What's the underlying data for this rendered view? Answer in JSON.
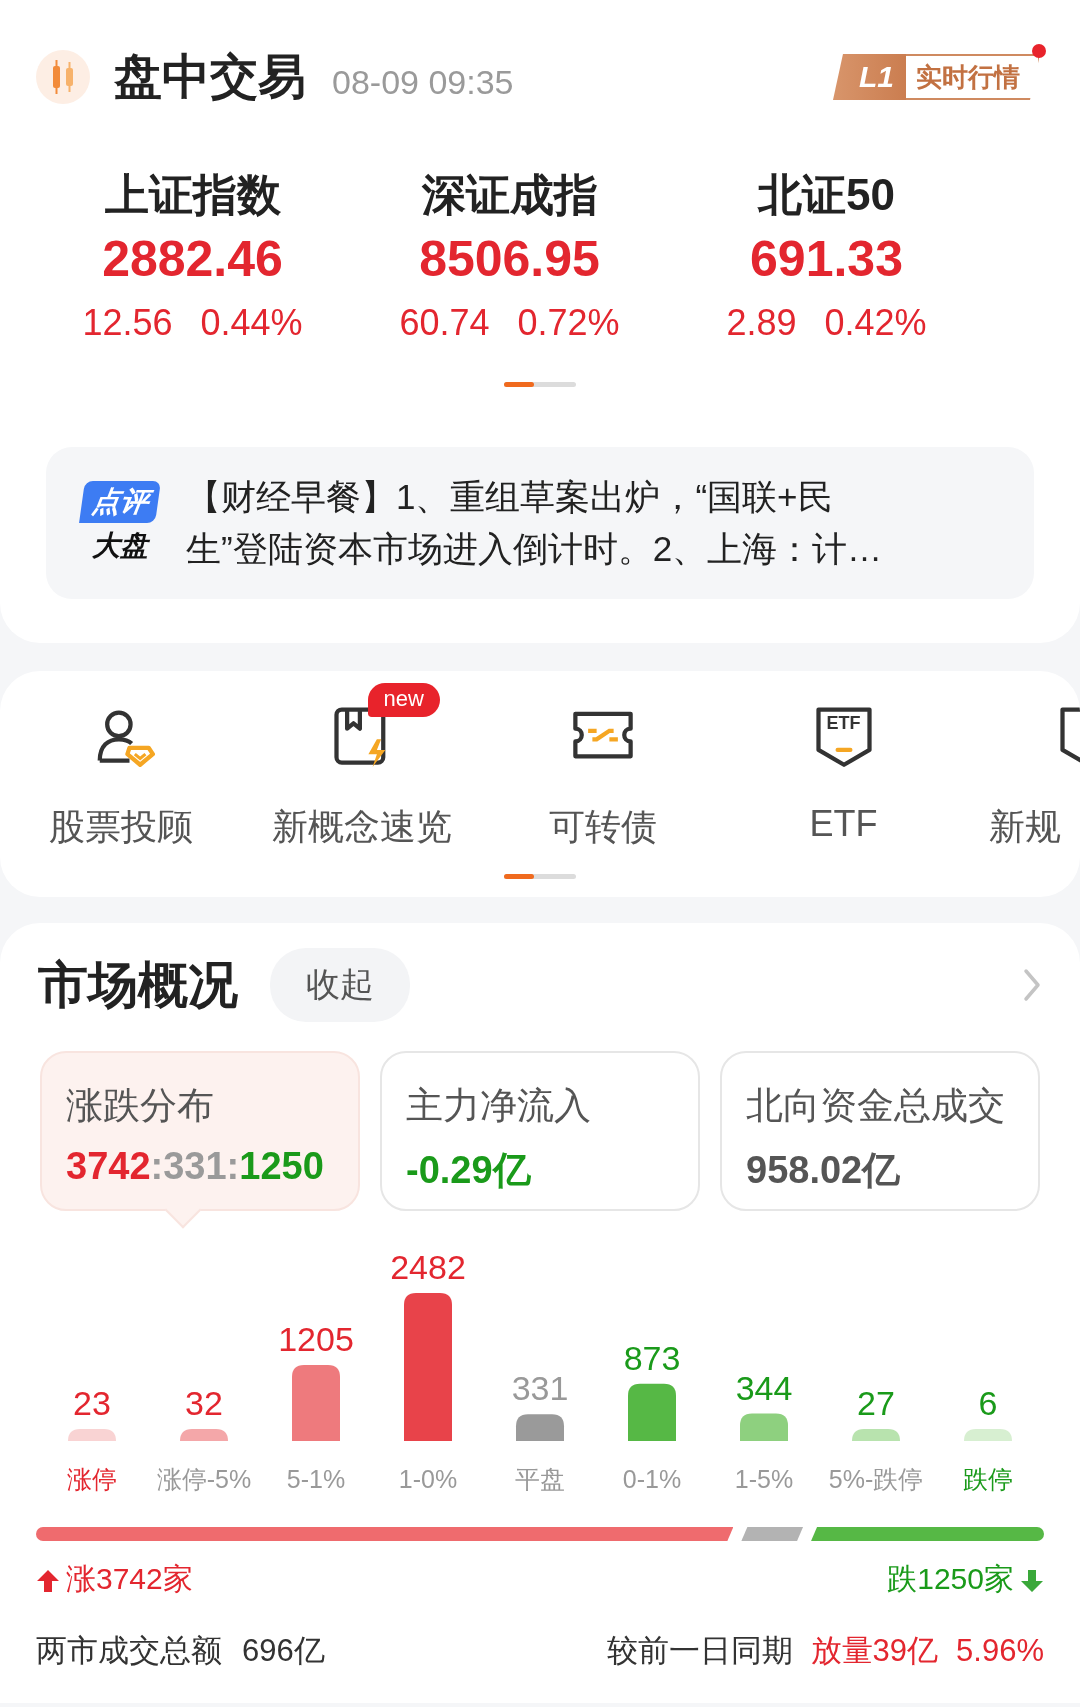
{
  "header": {
    "title": "盘中交易",
    "time": "08-09 09:35",
    "badge": {
      "tag": "L1",
      "label": "实时行情",
      "notification": true
    }
  },
  "indices": [
    {
      "name": "上证指数",
      "value": "2882.46",
      "change": "12.56",
      "percent": "0.44%",
      "kind": "up"
    },
    {
      "name": "深证成指",
      "value": "8506.95",
      "change": "60.74",
      "percent": "0.72%",
      "kind": "up"
    },
    {
      "name": "北证50",
      "value": "691.33",
      "change": "2.89",
      "percent": "0.42%",
      "kind": "up"
    }
  ],
  "news": {
    "tag_top": "点评",
    "tag_bottom": "大盘",
    "text": "【财经早餐】1、重组草案出炉，“国联+民生”登陆资本市场进入倒计时。2、上海：计…"
  },
  "shortcuts": [
    {
      "label": "股票投顾",
      "kind": "advisor"
    },
    {
      "label": "新概念速览",
      "kind": "concept",
      "badge": "new"
    },
    {
      "label": "可转债",
      "kind": "bond"
    },
    {
      "label": "ETF",
      "kind": "etf",
      "icon_text": "ETF"
    },
    {
      "label": "新规",
      "kind": "rules"
    }
  ],
  "market": {
    "title": "市场概况",
    "collapse_button": "收起",
    "stats": [
      {
        "label": "涨跌分布",
        "selected": true,
        "parts": [
          {
            "text": "3742",
            "kind": "up"
          },
          {
            "text": ":331:",
            "kind": "flat"
          },
          {
            "text": "1250",
            "kind": "down"
          }
        ]
      },
      {
        "label": "主力净流入",
        "selected": false,
        "parts": [
          {
            "text": "-0.29亿",
            "kind": "down"
          }
        ]
      },
      {
        "label": "北向资金总成交",
        "selected": false,
        "parts": [
          {
            "text": "958.02亿",
            "kind": "neutral"
          }
        ]
      }
    ],
    "distribution": [
      {
        "count": "23",
        "label": "涨停",
        "color": "#f9d3d3",
        "kind": "limit_up"
      },
      {
        "count": "32",
        "label": "涨停-5%",
        "color": "#f4a7a9",
        "kind": "up"
      },
      {
        "count": "1205",
        "label": "5-1%",
        "color": "#ee7a7d",
        "kind": "up"
      },
      {
        "count": "2482",
        "label": "1-0%",
        "color": "#e8434a",
        "kind": "up"
      },
      {
        "count": "331",
        "label": "平盘",
        "color": "#9a9a9a",
        "kind": "flat"
      },
      {
        "count": "873",
        "label": "0-1%",
        "color": "#56b845",
        "kind": "down"
      },
      {
        "count": "344",
        "label": "1-5%",
        "color": "#8ed07f",
        "kind": "down"
      },
      {
        "count": "27",
        "label": "5%-跌停",
        "color": "#b8e3ae",
        "kind": "down"
      },
      {
        "count": "6",
        "label": "跌停",
        "color": "#d7efd1",
        "kind": "limit_down"
      }
    ],
    "breadth": {
      "segments": [
        {
          "color": "#ef6b6e"
        },
        {
          "color": "#b3b3b3"
        },
        {
          "color": "#56b845"
        }
      ],
      "up_label": "涨3742家",
      "down_label": "跌1250家"
    },
    "summary": {
      "label": "两市成交总额",
      "value": "696亿",
      "compare_label": "较前一日同期",
      "compare_value": "放量39亿",
      "compare_percent": "5.96%"
    }
  }
}
